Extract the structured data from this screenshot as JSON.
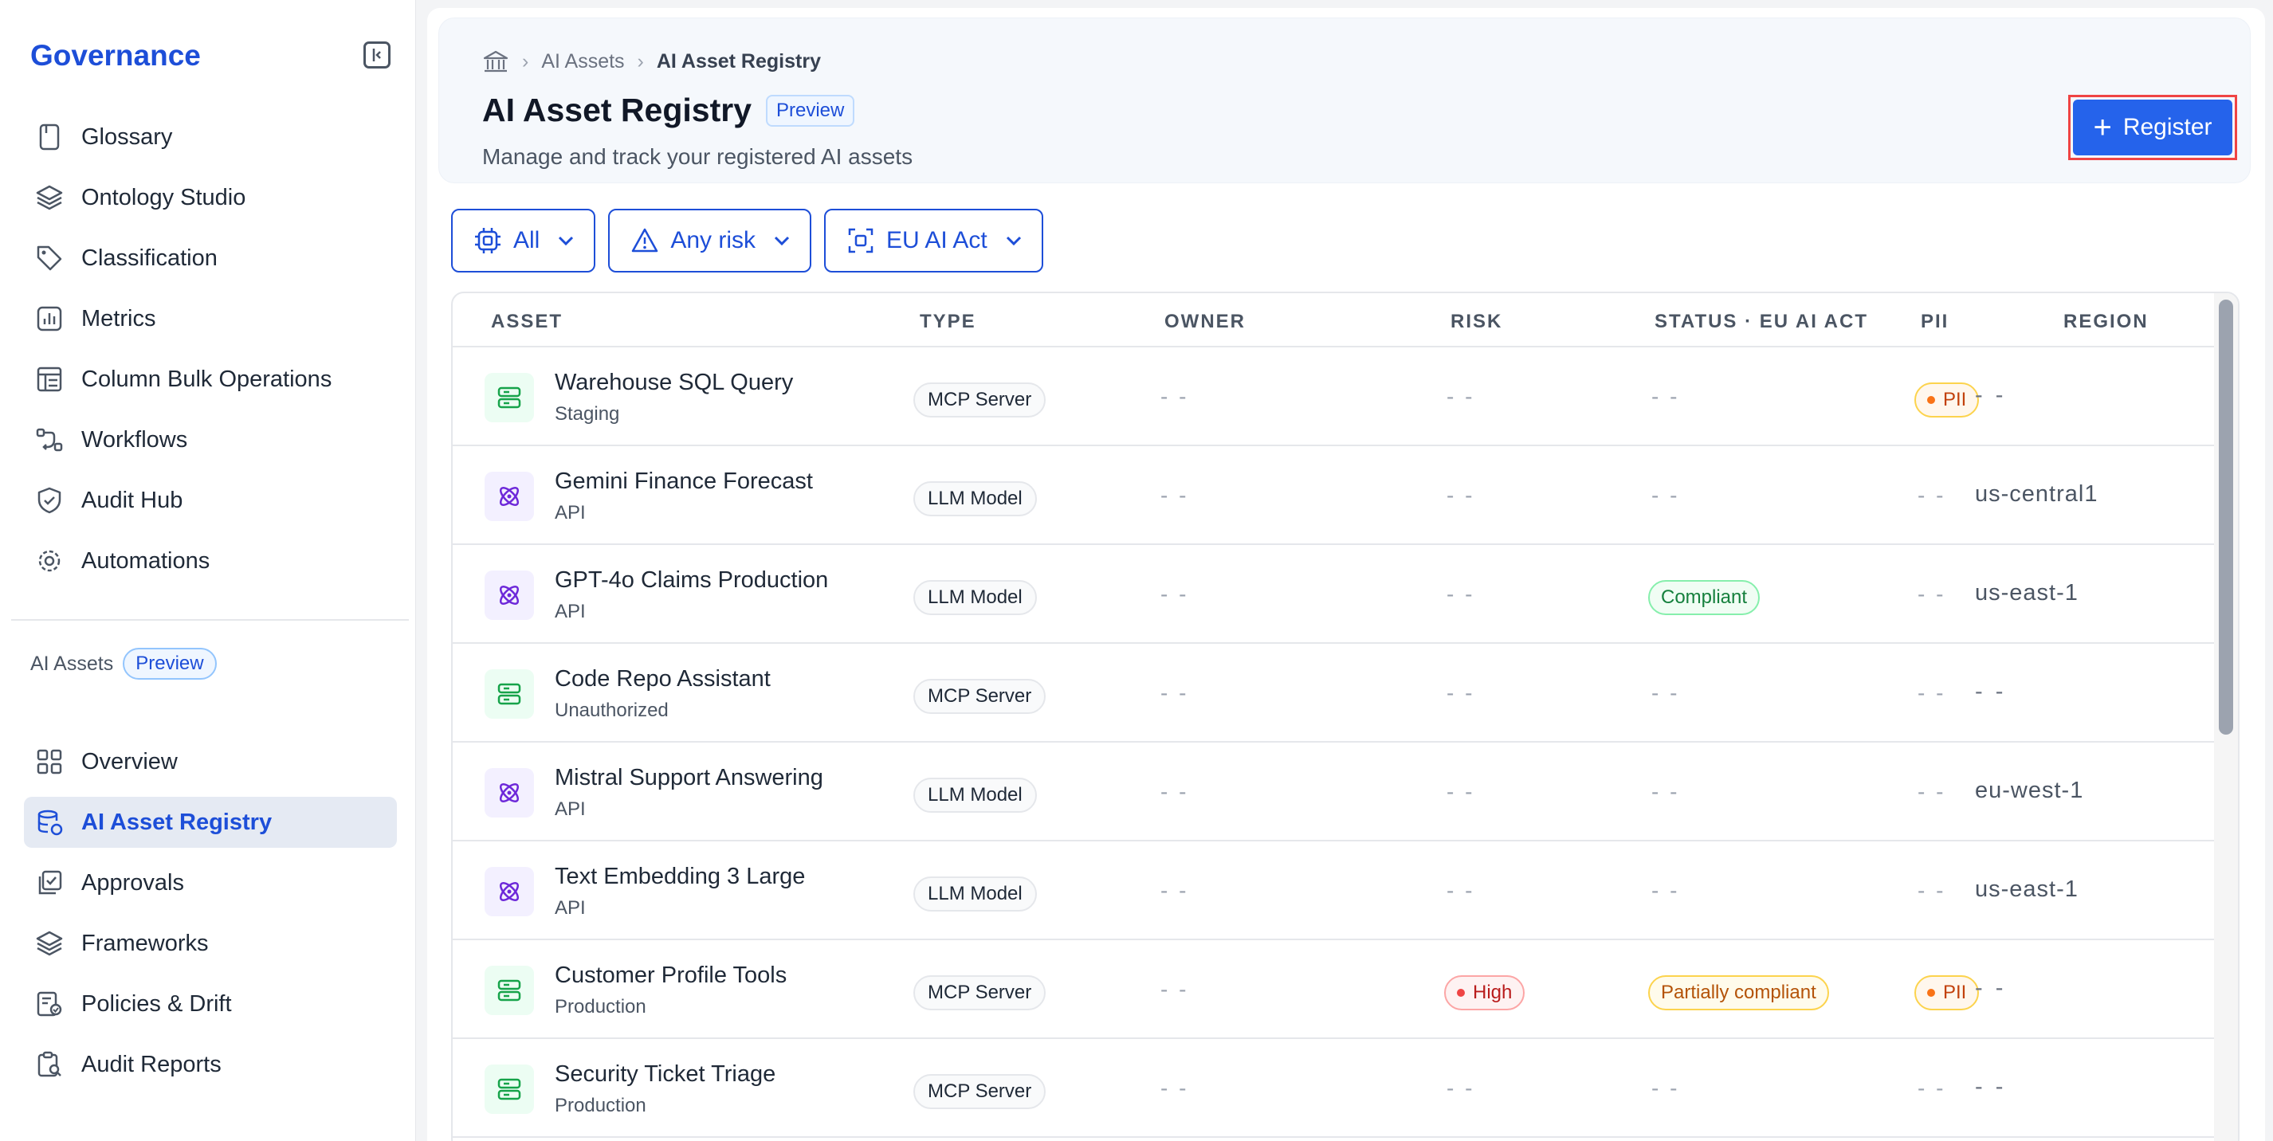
{
  "sidebar": {
    "title": "Governance",
    "group1": [
      {
        "label": "Glossary",
        "icon": "book-icon"
      },
      {
        "label": "Ontology Studio",
        "icon": "layers-icon"
      },
      {
        "label": "Classification",
        "icon": "tag-icon"
      },
      {
        "label": "Metrics",
        "icon": "chart-icon"
      },
      {
        "label": "Column Bulk Operations",
        "icon": "table-icon"
      },
      {
        "label": "Workflows",
        "icon": "workflow-icon"
      },
      {
        "label": "Audit Hub",
        "icon": "shield-icon"
      },
      {
        "label": "Automations",
        "icon": "gear-icon"
      }
    ],
    "section_label": "AI Assets",
    "section_badge": "Preview",
    "group2": [
      {
        "label": "Overview",
        "icon": "grid-icon"
      },
      {
        "label": "AI Asset Registry",
        "icon": "database-icon",
        "active": true
      },
      {
        "label": "Approvals",
        "icon": "approval-icon"
      },
      {
        "label": "Frameworks",
        "icon": "layers-icon"
      },
      {
        "label": "Policies & Drift",
        "icon": "policy-icon"
      },
      {
        "label": "Audit Reports",
        "icon": "report-icon"
      }
    ]
  },
  "breadcrumb": {
    "level1": "AI Assets",
    "current": "AI Asset Registry"
  },
  "header": {
    "title": "AI Asset Registry",
    "badge": "Preview",
    "subtitle": "Manage and track your registered AI assets",
    "register_label": "Register"
  },
  "filters": {
    "type": "All",
    "risk": "Any risk",
    "framework": "EU AI Act"
  },
  "table": {
    "columns": {
      "asset": "ASSET",
      "type": "TYPE",
      "owner": "OWNER",
      "risk": "RISK",
      "status": "STATUS · EU AI ACT",
      "pii": "PII",
      "region": "REGION"
    },
    "rows": [
      {
        "name": "Warehouse SQL Query",
        "sub": "Staging",
        "type": "MCP Server",
        "owner": "- -",
        "risk": "- -",
        "status": "- -",
        "pii": "PII",
        "region": "- -"
      },
      {
        "name": "Gemini Finance Forecast",
        "sub": "API",
        "type": "LLM Model",
        "owner": "- -",
        "risk": "- -",
        "status": "- -",
        "pii": "- -",
        "region": "us-central1"
      },
      {
        "name": "GPT-4o Claims Production",
        "sub": "API",
        "type": "LLM Model",
        "owner": "- -",
        "risk": "- -",
        "status": "Compliant",
        "pii": "- -",
        "region": "us-east-1"
      },
      {
        "name": "Code Repo Assistant",
        "sub": "Unauthorized",
        "type": "MCP Server",
        "owner": "- -",
        "risk": "- -",
        "status": "- -",
        "pii": "- -",
        "region": "- -"
      },
      {
        "name": "Mistral Support Answering",
        "sub": "API",
        "type": "LLM Model",
        "owner": "- -",
        "risk": "- -",
        "status": "- -",
        "pii": "- -",
        "region": "eu-west-1"
      },
      {
        "name": "Text Embedding 3 Large",
        "sub": "API",
        "type": "LLM Model",
        "owner": "- -",
        "risk": "- -",
        "status": "- -",
        "pii": "- -",
        "region": "us-east-1"
      },
      {
        "name": "Customer Profile Tools",
        "sub": "Production",
        "type": "MCP Server",
        "owner": "- -",
        "risk": "High",
        "status": "Partially compliant",
        "pii": "PII",
        "region": "- -"
      },
      {
        "name": "Security Ticket Triage",
        "sub": "Production",
        "type": "MCP Server",
        "owner": "- -",
        "risk": "- -",
        "status": "- -",
        "pii": "- -",
        "region": "- -"
      }
    ]
  },
  "colors": {
    "accent": "#2563eb",
    "brand": "#1d4ed8",
    "highlight_outline": "#ef4444"
  }
}
